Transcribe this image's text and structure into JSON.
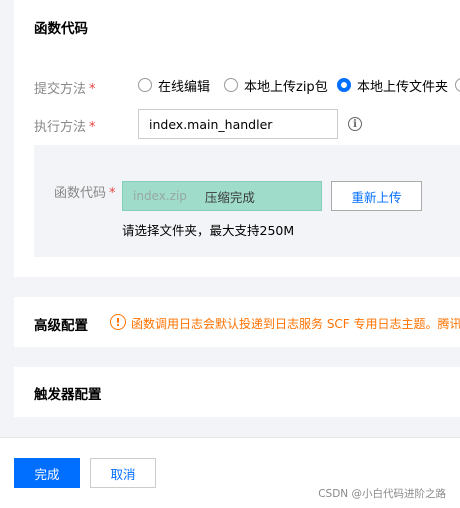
{
  "function_code": {
    "title": "函数代码",
    "submit_label": "提交方法",
    "required_mark": "*",
    "submit_options": [
      {
        "label": "在线编辑",
        "checked": false
      },
      {
        "label": "本地上传zip包",
        "checked": false
      },
      {
        "label": "本地上传文件夹",
        "checked": true
      }
    ],
    "handler_label": "执行方法",
    "handler_value": "index.main_handler",
    "info_icon": "info-icon",
    "code_label": "函数代码",
    "file_name": "index.zip",
    "upload_status": "压缩完成",
    "reupload_label": "重新上传",
    "hint": "请选择文件夹，最大支持250M"
  },
  "advanced": {
    "title": "高级配置",
    "warning_icon": "exclamation-circle-icon",
    "notice": "函数调用日志会默认投递到日志服务 SCF 专用日志主题。腾讯"
  },
  "trigger": {
    "title": "触发器配置"
  },
  "footer": {
    "ok_label": "完成",
    "cancel_label": "取消",
    "watermark": "CSDN @小白代码进阶之路"
  },
  "colors": {
    "primary": "#006eff",
    "warning": "#ff7200",
    "upload_bg": "#9fdcca",
    "required": "#e54545"
  }
}
